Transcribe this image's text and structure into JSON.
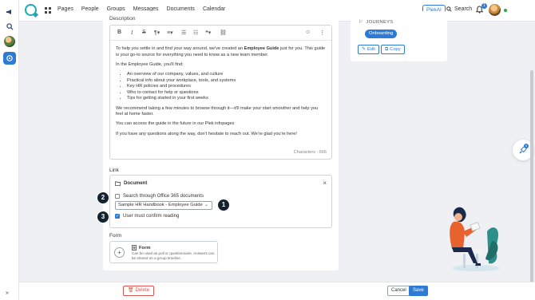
{
  "nav": {
    "links": [
      "Pages",
      "People",
      "Groups",
      "Messages",
      "Documents",
      "Calendar"
    ],
    "plekai_label": "PlekAI",
    "search_label": "Search",
    "notifications_count": "1"
  },
  "editor": {
    "label": "Description",
    "intro_before": "To help you settle in and find your way around, we've created an ",
    "intro_bold": "Employee Guide",
    "intro_after": " just for you. This guide is your go-to source for everything you need to know as a new team member.",
    "find_heading": "In the Employee Guide, you'll find:",
    "bullets": [
      "An overview of our company, values, and culture",
      "Practical info about your workplace, tools, and systems",
      "Key HR policies and procedures",
      "Who to contact for help or questions",
      "Tips for getting started in your first weeks"
    ],
    "recommend": "We recommend taking a few minutes to browse through it—it'll make your start smoother and help you feel at home faster.",
    "access": "You can access the guide in the future in our Plek infopages",
    "closing": "If you have any questions along the way, don't hesitate to reach out. We're glad you're here!",
    "characters_label": "Characters : 666"
  },
  "link": {
    "label": "Link",
    "doc_title": "Document",
    "office_checkbox_label": "Search through Office 365 documents",
    "office_checked": false,
    "selected_document": "Sample HR Handbook - Employee Guide",
    "confirm_label": "User must confirm reading",
    "confirm_checked": true
  },
  "steps": [
    "1",
    "2",
    "3"
  ],
  "form": {
    "label": "Form",
    "title": "Form",
    "description": "Can be used as poll or questionnaire. Answers can be shared on a group timeline."
  },
  "journeys": {
    "heading": "JOURNEYS",
    "chip": "Onboarding",
    "edit_label": "Edit",
    "copy_label": "Copy"
  },
  "fab_badge": "0",
  "footer": {
    "delete_label": "Delete",
    "cancel_label": "Cancel",
    "save_label": "Save"
  },
  "colors": {
    "accent": "#2e7bd6",
    "danger": "#d9534f",
    "step_badge": "#14222f"
  }
}
